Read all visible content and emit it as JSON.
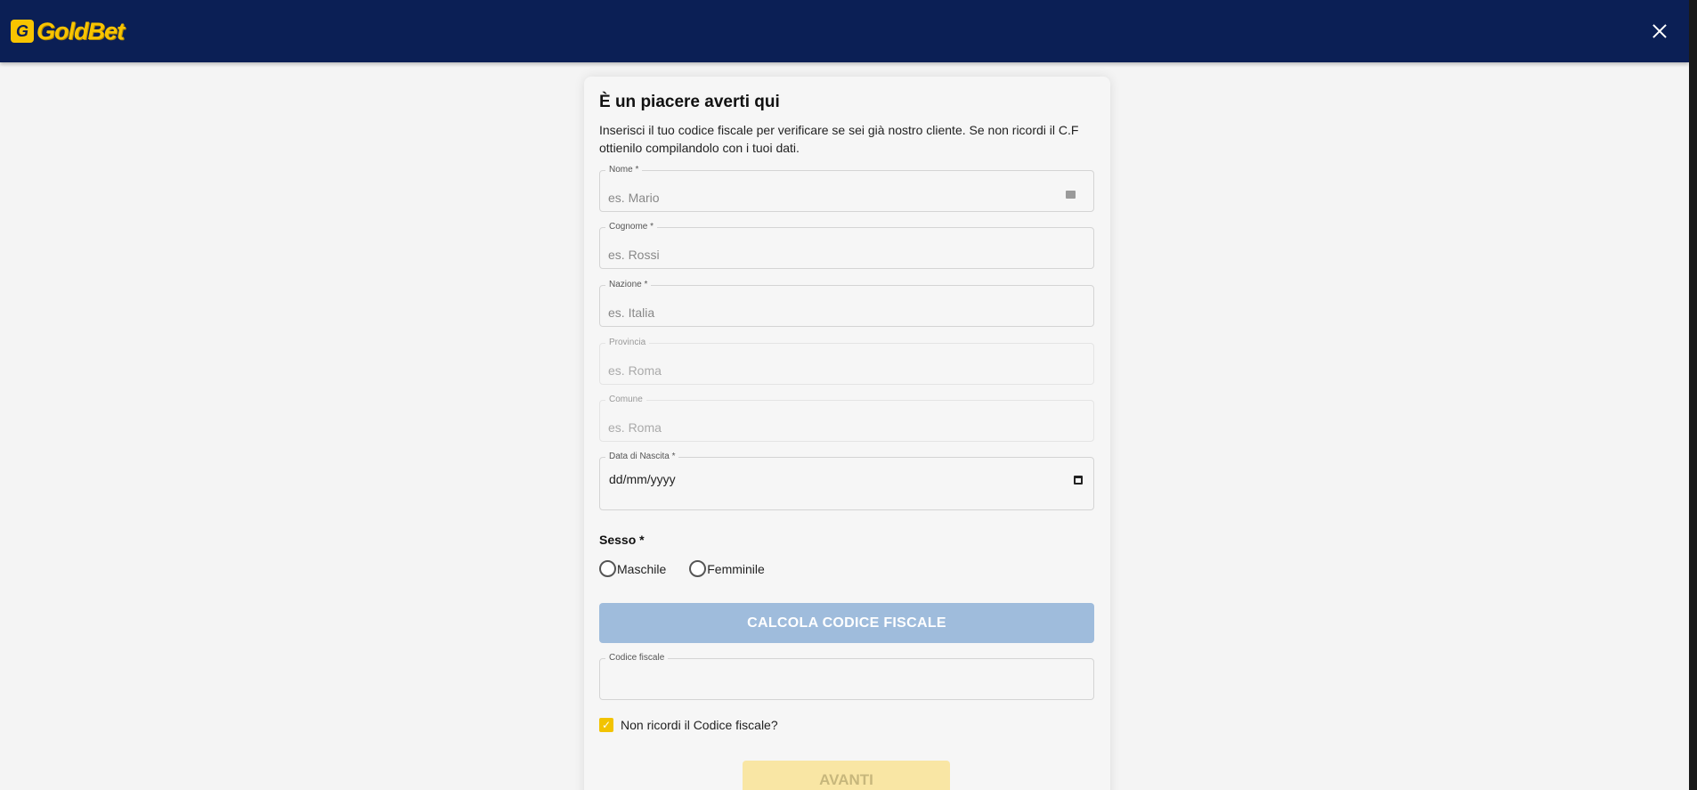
{
  "header": {
    "logo_mark": "G",
    "logo_text": "GoldBet",
    "brand_color": "#f8c400",
    "bar_color": "#0b1f55"
  },
  "form": {
    "title": "È un piacere averti qui",
    "description": "Inserisci il tuo codice fiscale per verificare se sei già nostro cliente. Se non ricordi il C.F ottienilo compilandolo con i tuoi dati.",
    "fields": {
      "nome": {
        "label": "Nome *",
        "placeholder": "es. Mario",
        "value": ""
      },
      "cognome": {
        "label": "Cognome *",
        "placeholder": "es. Rossi",
        "value": ""
      },
      "nazione": {
        "label": "Nazione *",
        "placeholder": "es. Italia",
        "value": ""
      },
      "provincia": {
        "label": "Provincia",
        "placeholder": "es. Roma",
        "value": ""
      },
      "comune": {
        "label": "Comune",
        "placeholder": "es. Roma",
        "value": ""
      },
      "data_nascita": {
        "label": "Data di Nascita *",
        "value": "dd/mm/yyyy"
      },
      "codice_fiscale": {
        "label": "Codice fiscale",
        "placeholder": "",
        "value": ""
      }
    },
    "sesso": {
      "label": "Sesso *",
      "options": [
        "Maschile",
        "Femminile"
      ]
    },
    "calc_button": "CALCOLA CODICE FISCALE",
    "forgot_checkbox": {
      "label": "Non ricordi il Codice fiscale?",
      "checked": true,
      "checkmark": "✓"
    },
    "next_button": "AVANTI"
  }
}
